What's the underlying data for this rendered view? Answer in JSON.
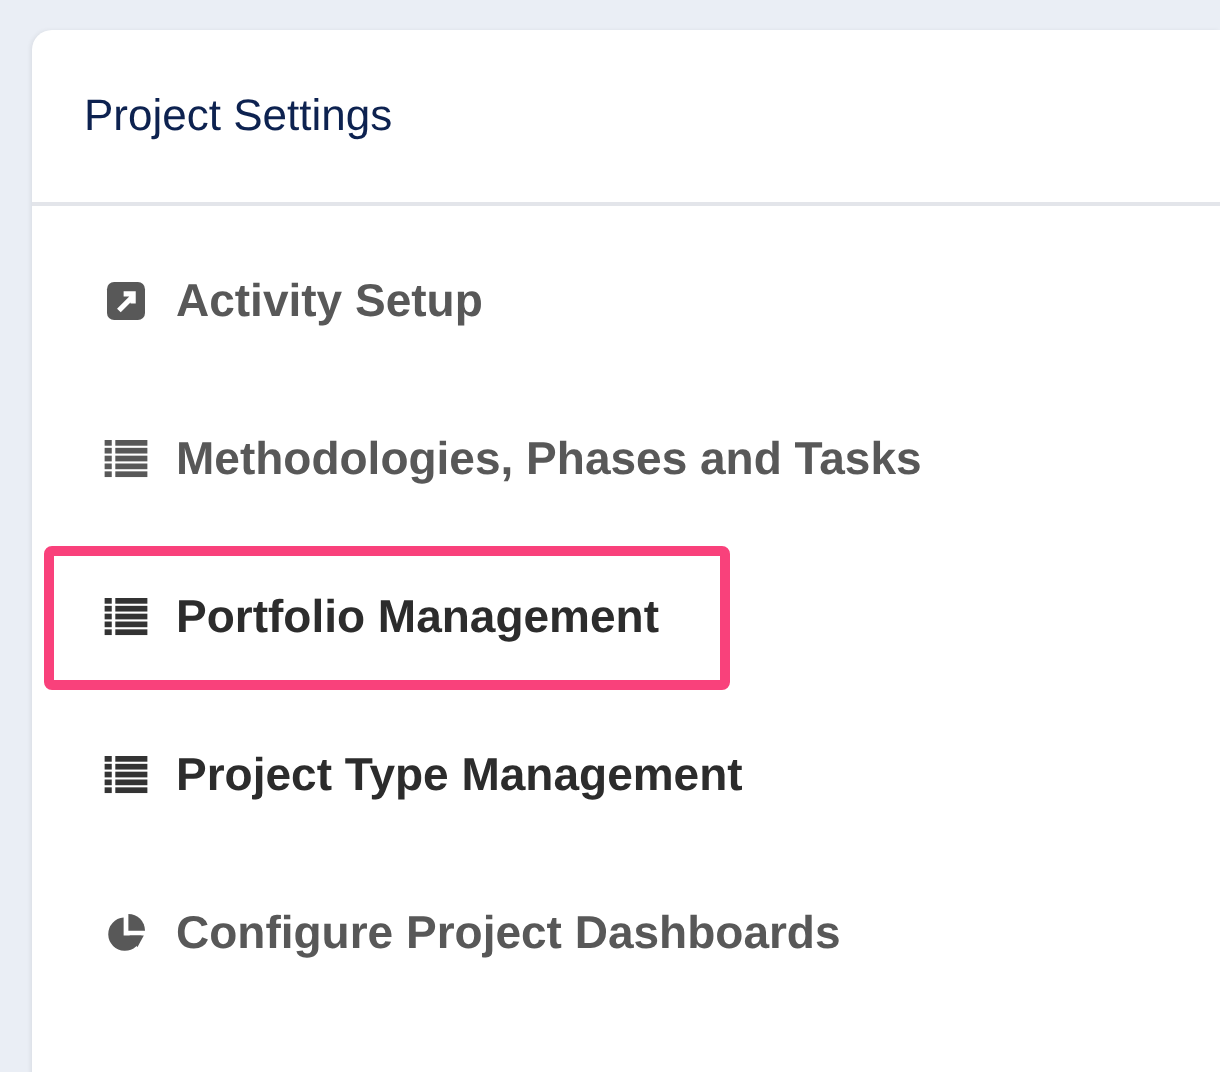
{
  "panel": {
    "title": "Project Settings"
  },
  "items": [
    {
      "label": "Activity Setup",
      "kind": "external",
      "active": false,
      "highlighted": false
    },
    {
      "label": "Methodologies, Phases and Tasks",
      "kind": "list",
      "active": false,
      "highlighted": false
    },
    {
      "label": "Portfolio Management",
      "kind": "list",
      "active": true,
      "highlighted": true
    },
    {
      "label": "Project Type Management",
      "kind": "list",
      "active": true,
      "highlighted": false
    },
    {
      "label": "Configure Project Dashboards",
      "kind": "pie",
      "active": false,
      "highlighted": false
    }
  ]
}
